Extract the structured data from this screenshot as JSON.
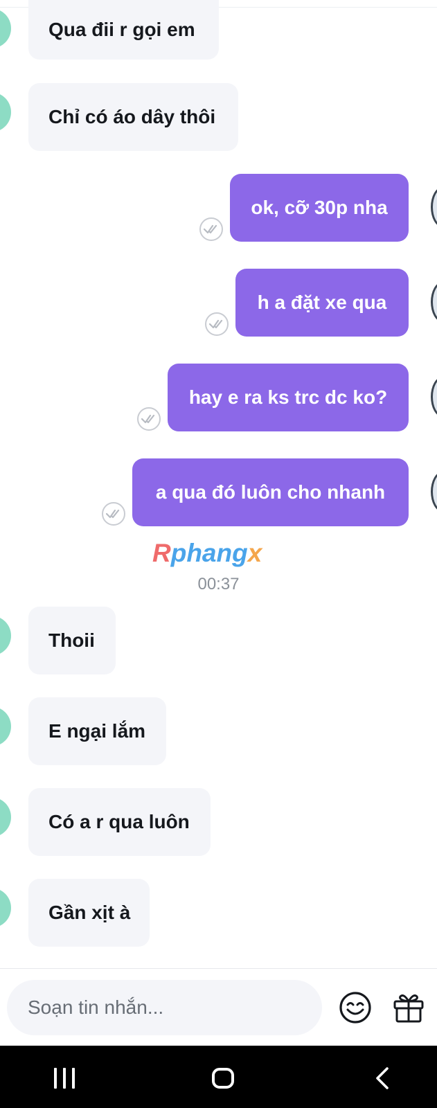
{
  "messages": [
    {
      "side": "in",
      "text": "Qua đii r gọi em"
    },
    {
      "side": "in",
      "text": "Chỉ có áo dây thôi"
    },
    {
      "side": "out",
      "text": "ok, cỡ 30p nha"
    },
    {
      "side": "out",
      "text": "h a đặt xe qua"
    },
    {
      "side": "out",
      "text": "hay e ra ks trc dc ko?"
    },
    {
      "side": "out",
      "text": "a qua đó luôn cho nhanh"
    },
    {
      "side": "in",
      "text": "Thoii"
    },
    {
      "side": "in",
      "text": "E ngại lắm"
    },
    {
      "side": "in",
      "text": "Có a r qua luôn"
    },
    {
      "side": "in",
      "text": "Gần xịt à"
    }
  ],
  "watermark": {
    "part1": "R",
    "part2": "phang",
    "part3": "x"
  },
  "timestamp": "00:37",
  "composer": {
    "placeholder": "Soạn tin nhắn..."
  },
  "icons": {
    "seen": "double-check-icon",
    "emoji": "smiley-icon",
    "gift": "gift-icon",
    "nav": [
      "recent-apps-icon",
      "home-icon",
      "back-icon"
    ]
  },
  "colors": {
    "outgoing_bubble": "#8c68e8",
    "incoming_bubble": "#f4f5f9",
    "text": "#15181d",
    "timestamp": "#8b9199"
  }
}
